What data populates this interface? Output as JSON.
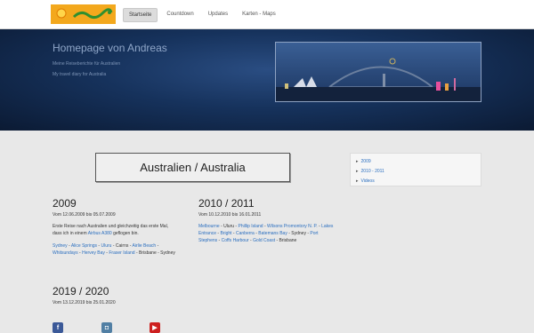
{
  "nav": {
    "items": [
      {
        "label": "Startseite",
        "active": true
      },
      {
        "label": "Countdown",
        "active": false
      },
      {
        "label": "Updates",
        "active": false
      },
      {
        "label": "Karten - Maps",
        "active": false
      }
    ]
  },
  "hero": {
    "title": "Homepage von Andreas",
    "subtitle1": "Meine Reiseberichte für Australien",
    "subtitle2": "My travel diary for Australia"
  },
  "main": {
    "heading": "Australien / Australia"
  },
  "sidebar": {
    "items": [
      "2009",
      "2010 - 2011",
      "Videos"
    ]
  },
  "trip2009": {
    "title": "2009",
    "date": "Vom 12.06.2009 bis 05.07.2009",
    "text1": "Erste Reise nach Australien und gleichzeitig das erste Mal,",
    "text2a": "dass ich in einem ",
    "text2link": "Airbus A380",
    "text2b": " geflogen bin.",
    "places": [
      {
        "text": "Sydney",
        "link": true
      },
      {
        "text": " - ",
        "link": false
      },
      {
        "text": "Alice Springs",
        "link": true
      },
      {
        "text": " - ",
        "link": false
      },
      {
        "text": "Uluru",
        "link": true
      },
      {
        "text": " - Cairns - ",
        "link": false
      },
      {
        "text": "Airlie Beach",
        "link": true
      },
      {
        "text": " - ",
        "link": false
      },
      {
        "text": "Whitsundays",
        "link": true
      },
      {
        "text": " - ",
        "link": false
      },
      {
        "text": "Hervey Bay",
        "link": true
      },
      {
        "text": " - ",
        "link": false
      },
      {
        "text": "Fraser Island",
        "link": true
      },
      {
        "text": " - Brisbane - Sydney",
        "link": false
      }
    ]
  },
  "trip2010": {
    "title": "2010 / 2011",
    "date": "Vom 10.12.2010 bis 16.01.2011",
    "places": [
      {
        "text": "Melbourne",
        "link": true
      },
      {
        "text": " - Uluru - ",
        "link": false
      },
      {
        "text": "Phillip Island",
        "link": true
      },
      {
        "text": " - ",
        "link": false
      },
      {
        "text": "Wilsons Promontory N. P.",
        "link": true
      },
      {
        "text": " - ",
        "link": false
      },
      {
        "text": "Lakes Entrance",
        "link": true
      },
      {
        "text": " - ",
        "link": false
      },
      {
        "text": "Bright",
        "link": true
      },
      {
        "text": " - ",
        "link": false
      },
      {
        "text": "Canberra",
        "link": true
      },
      {
        "text": " - ",
        "link": false
      },
      {
        "text": "Batemans Bay",
        "link": true
      },
      {
        "text": " - Sydney - ",
        "link": false
      },
      {
        "text": "Port Stephens",
        "link": true
      },
      {
        "text": " - ",
        "link": false
      },
      {
        "text": "Coffs Harbour",
        "link": true
      },
      {
        "text": " - ",
        "link": false
      },
      {
        "text": "Gold Coast",
        "link": true
      },
      {
        "text": " - Brisbane",
        "link": false
      }
    ]
  },
  "trip2019": {
    "title": "2019 / 2020",
    "date": "Vom 13.12.2019 bis 25.01.2020"
  },
  "social": {
    "facebook": "f",
    "instagram": "◘",
    "youtube": "▶"
  },
  "colors": {
    "link": "#2a6ebf",
    "facebook": "#3b5998",
    "instagram": "#517fa4",
    "youtube": "#cd201f"
  }
}
